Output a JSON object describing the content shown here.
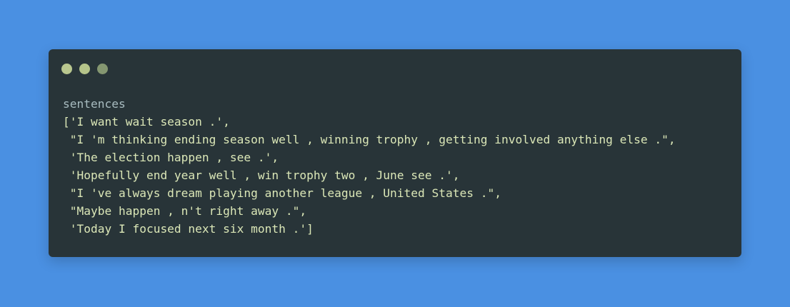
{
  "code": {
    "input": "sentences",
    "output_lines": [
      "['I want wait season .',",
      " \"I 'm thinking ending season well , winning trophy , getting involved anything else .\",",
      " 'The election happen , see .',",
      " 'Hopefully end year well , win trophy two , June see .',",
      " \"I 've always dream playing another league , United States .\",",
      " \"Maybe happen , n't right away .\",",
      " 'Today I focused next six month .']"
    ]
  },
  "colors": {
    "background": "#4a90e2",
    "window": "#283438",
    "output_text": "#dbe7b7",
    "input_text": "#a8bcc0"
  }
}
